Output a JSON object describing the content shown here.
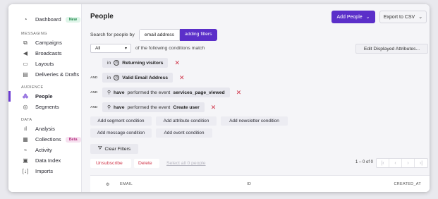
{
  "sidebar": {
    "items": [
      {
        "label": "Dashboard",
        "icon": "dashboard-icon",
        "badge": "New"
      },
      {
        "section": "MESSAGING"
      },
      {
        "label": "Campaigns",
        "icon": "campaigns-icon"
      },
      {
        "label": "Broadcasts",
        "icon": "megaphone-icon"
      },
      {
        "label": "Layouts",
        "icon": "layouts-icon"
      },
      {
        "label": "Deliveries & Drafts",
        "icon": "deliveries-icon"
      },
      {
        "section": "AUDIENCE"
      },
      {
        "label": "People",
        "icon": "people-icon",
        "active": true
      },
      {
        "label": "Segments",
        "icon": "segments-icon"
      },
      {
        "section": "DATA"
      },
      {
        "label": "Analysis",
        "icon": "analysis-icon"
      },
      {
        "label": "Collections",
        "icon": "collections-icon",
        "badge": "Beta"
      },
      {
        "label": "Activity",
        "icon": "activity-icon"
      },
      {
        "label": "Data Index",
        "icon": "data-index-icon"
      },
      {
        "label": "Imports",
        "icon": "imports-icon"
      }
    ]
  },
  "header": {
    "title": "People",
    "add_people": "Add People",
    "export": "Export to CSV"
  },
  "search": {
    "label": "Search for people by",
    "tab_email": "email address",
    "tab_filters": "adding filters"
  },
  "conditions": {
    "match_select": "All",
    "match_text": "of the following conditions match",
    "edit_button": "Edit Displayed Attributes...",
    "rows": [
      {
        "and": "",
        "in": "in",
        "bold": "Returning visitors",
        "rest": ""
      },
      {
        "and": "AND",
        "in": "in",
        "bold": "Valid Email Address",
        "rest": ""
      },
      {
        "and": "AND",
        "in": "",
        "bold": "have",
        "rest": "performed the event",
        "event": "services_page_viewed"
      },
      {
        "and": "AND",
        "in": "",
        "bold": "have",
        "rest": "performed the event",
        "event": "Create user"
      }
    ]
  },
  "add_buttons": {
    "segment": "Add segment condition",
    "attribute": "Add attribute condition",
    "newsletter": "Add newsletter condition",
    "message": "Add message condition",
    "event": "Add event condition"
  },
  "clear_filters": "Clear Filters",
  "actions": {
    "unsubscribe": "Unsubscribe",
    "delete": "Delete",
    "select_all": "Select all 0 people"
  },
  "pagination": {
    "range": "1 – 0 of 0"
  },
  "table": {
    "columns": [
      "EMAIL",
      "ID",
      "CREATED_AT"
    ]
  },
  "colors": {
    "accent": "#5b2fc9",
    "danger": "#d0364a"
  }
}
